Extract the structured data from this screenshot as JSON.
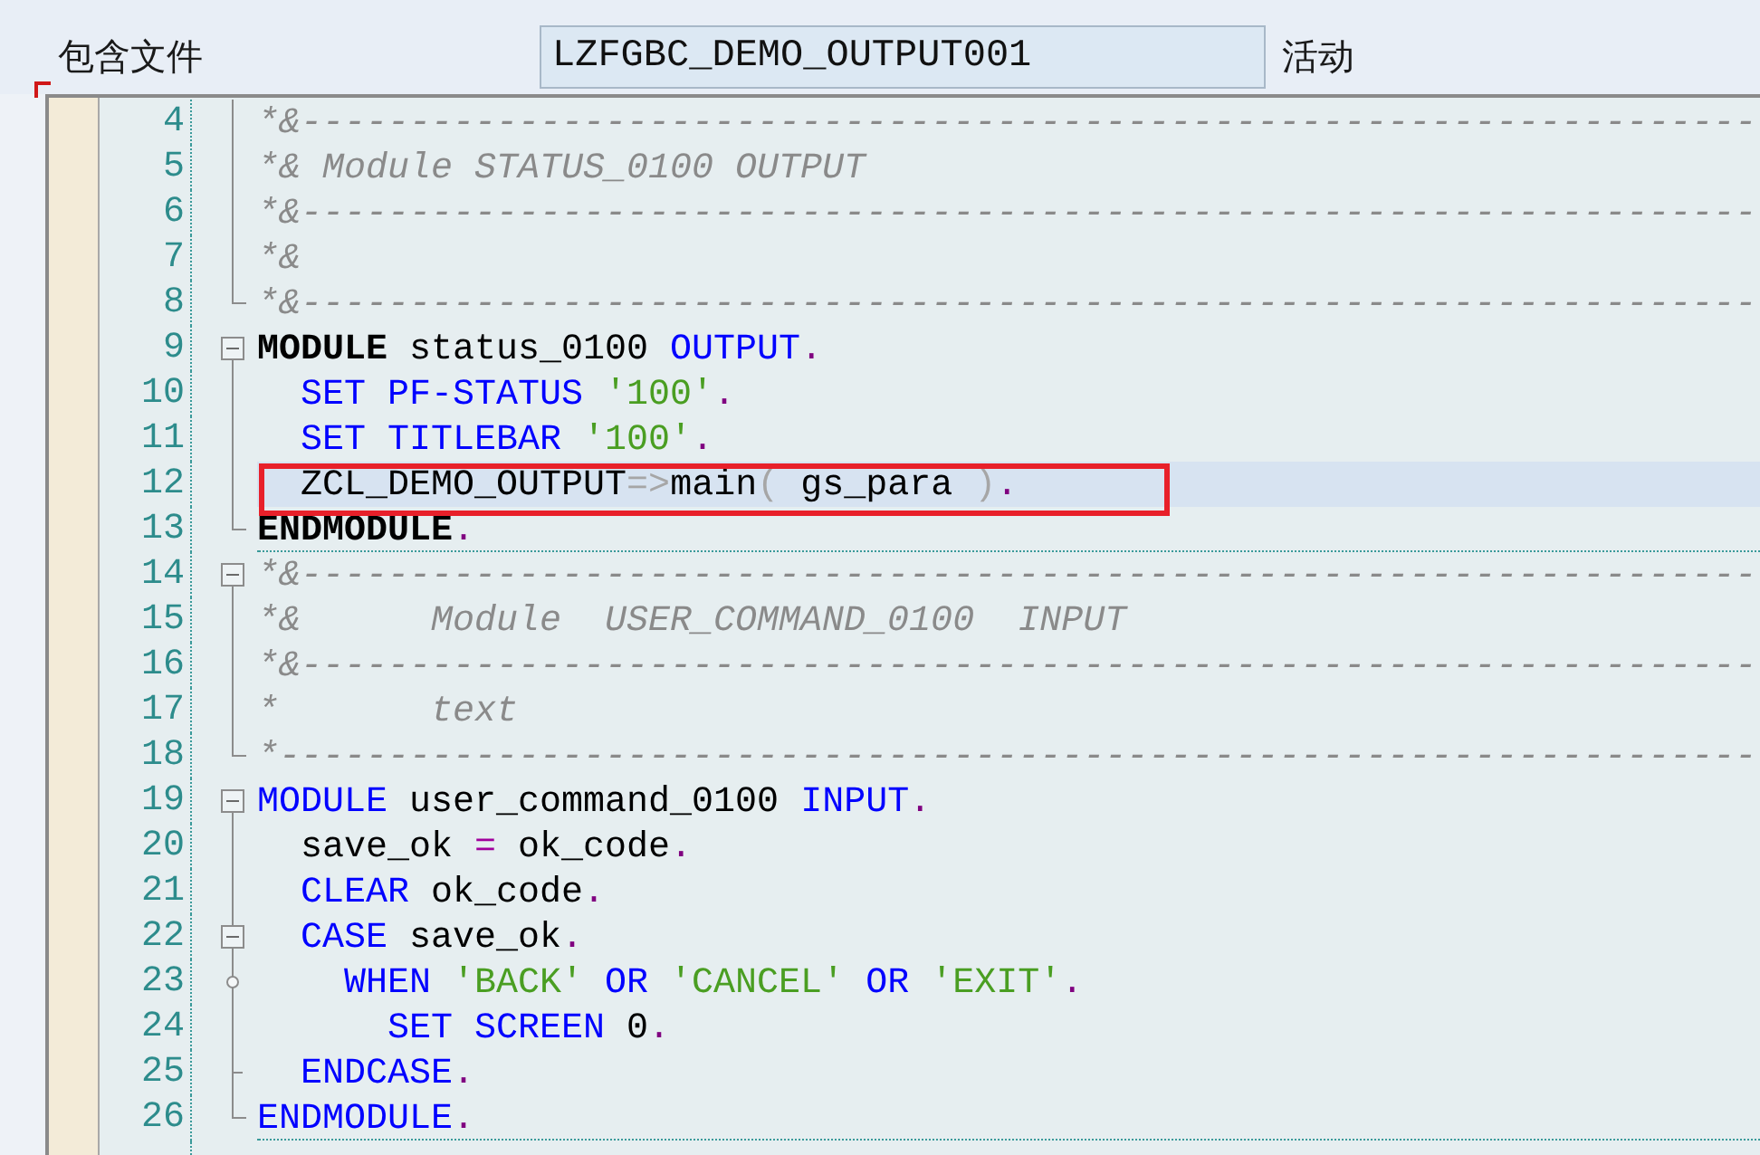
{
  "header": {
    "label": "包含文件",
    "file_name": "LZFGBC_DEMO_OUTPUT001",
    "status": "活动"
  },
  "editor": {
    "lines": [
      {
        "number": "4",
        "fold": {
          "kind": "line"
        },
        "current": false,
        "boxed": false,
        "block_end": false,
        "tokens": [
          {
            "text": "*&-------------------------------------------------------------------",
            "kind": "comment"
          }
        ]
      },
      {
        "number": "5",
        "fold": {
          "kind": "line"
        },
        "current": false,
        "boxed": false,
        "block_end": false,
        "tokens": [
          {
            "text": "*& Module STATUS_0100 OUTPUT",
            "kind": "comment"
          }
        ]
      },
      {
        "number": "6",
        "fold": {
          "kind": "line"
        },
        "current": false,
        "boxed": false,
        "block_end": false,
        "tokens": [
          {
            "text": "*&-------------------------------------------------------------------",
            "kind": "comment"
          }
        ]
      },
      {
        "number": "7",
        "fold": {
          "kind": "line"
        },
        "current": false,
        "boxed": false,
        "block_end": false,
        "tokens": [
          {
            "text": "*&",
            "kind": "comment"
          }
        ]
      },
      {
        "number": "8",
        "fold": {
          "kind": "end"
        },
        "current": false,
        "boxed": false,
        "block_end": false,
        "tokens": [
          {
            "text": "*&-------------------------------------------------------------------",
            "kind": "comment"
          }
        ]
      },
      {
        "number": "9",
        "fold": {
          "kind": "start",
          "expanded": true
        },
        "current": false,
        "boxed": false,
        "block_end": false,
        "tokens": [
          {
            "text": "MODULE",
            "kind": "keyword_bold"
          },
          {
            "text": " status_0100",
            "kind": "plain"
          },
          {
            "text": " OUTPUT",
            "kind": "keyword"
          },
          {
            "text": ".",
            "kind": "punct"
          }
        ]
      },
      {
        "number": "10",
        "fold": {
          "kind": "line"
        },
        "current": false,
        "boxed": false,
        "block_end": false,
        "tokens": [
          {
            "text": "  SET PF-STATUS",
            "kind": "keyword"
          },
          {
            "text": " '100'",
            "kind": "string"
          },
          {
            "text": ".",
            "kind": "punct"
          }
        ]
      },
      {
        "number": "11",
        "fold": {
          "kind": "line"
        },
        "current": false,
        "boxed": false,
        "block_end": false,
        "tokens": [
          {
            "text": "  SET TITLEBAR",
            "kind": "keyword"
          },
          {
            "text": " '100'",
            "kind": "string"
          },
          {
            "text": ".",
            "kind": "punct"
          }
        ]
      },
      {
        "number": "12",
        "fold": {
          "kind": "line"
        },
        "current": true,
        "boxed": true,
        "block_end": false,
        "tokens": [
          {
            "text": "  ZCL_DEMO_OUTPUT",
            "kind": "plain"
          },
          {
            "text": "=>",
            "kind": "symbol"
          },
          {
            "text": "main",
            "kind": "plain"
          },
          {
            "text": "(",
            "kind": "symbol"
          },
          {
            "text": " gs_para ",
            "kind": "plain"
          },
          {
            "text": ")",
            "kind": "symbol"
          },
          {
            "text": ".",
            "kind": "punct"
          }
        ]
      },
      {
        "number": "13",
        "fold": {
          "kind": "end"
        },
        "current": false,
        "boxed": false,
        "block_end": true,
        "tokens": [
          {
            "text": "ENDMODULE",
            "kind": "keyword_bold"
          },
          {
            "text": ".",
            "kind": "punct"
          }
        ]
      },
      {
        "number": "14",
        "fold": {
          "kind": "start",
          "expanded": true
        },
        "current": false,
        "boxed": false,
        "block_end": false,
        "tokens": [
          {
            "text": "*&-------------------------------------------------------------------",
            "kind": "comment"
          }
        ]
      },
      {
        "number": "15",
        "fold": {
          "kind": "line"
        },
        "current": false,
        "boxed": false,
        "block_end": false,
        "tokens": [
          {
            "text": "*&      Module  USER_COMMAND_0100  INPUT",
            "kind": "comment"
          }
        ]
      },
      {
        "number": "16",
        "fold": {
          "kind": "line"
        },
        "current": false,
        "boxed": false,
        "block_end": false,
        "tokens": [
          {
            "text": "*&-------------------------------------------------------------------",
            "kind": "comment"
          }
        ]
      },
      {
        "number": "17",
        "fold": {
          "kind": "line"
        },
        "current": false,
        "boxed": false,
        "block_end": false,
        "tokens": [
          {
            "text": "*       text",
            "kind": "comment"
          }
        ]
      },
      {
        "number": "18",
        "fold": {
          "kind": "end"
        },
        "current": false,
        "boxed": false,
        "block_end": false,
        "tokens": [
          {
            "text": "*--------------------------------------------------------------------",
            "kind": "comment"
          }
        ]
      },
      {
        "number": "19",
        "fold": {
          "kind": "start",
          "expanded": true
        },
        "current": false,
        "boxed": false,
        "block_end": false,
        "tokens": [
          {
            "text": "MODULE",
            "kind": "keyword"
          },
          {
            "text": " user_command_0100",
            "kind": "plain"
          },
          {
            "text": " INPUT",
            "kind": "keyword"
          },
          {
            "text": ".",
            "kind": "punct"
          }
        ]
      },
      {
        "number": "20",
        "fold": {
          "kind": "line"
        },
        "current": false,
        "boxed": false,
        "block_end": false,
        "tokens": [
          {
            "text": "  save_ok",
            "kind": "plain"
          },
          {
            "text": " =",
            "kind": "operator"
          },
          {
            "text": " ok_code",
            "kind": "plain"
          },
          {
            "text": ".",
            "kind": "punct"
          }
        ]
      },
      {
        "number": "21",
        "fold": {
          "kind": "line"
        },
        "current": false,
        "boxed": false,
        "block_end": false,
        "tokens": [
          {
            "text": "  CLEAR",
            "kind": "keyword"
          },
          {
            "text": " ok_code",
            "kind": "plain"
          },
          {
            "text": ".",
            "kind": "punct"
          }
        ]
      },
      {
        "number": "22",
        "fold": {
          "kind": "start",
          "expanded": true
        },
        "current": false,
        "boxed": false,
        "block_end": false,
        "tokens": [
          {
            "text": "  CASE",
            "kind": "keyword"
          },
          {
            "text": " save_ok",
            "kind": "plain"
          },
          {
            "text": ".",
            "kind": "punct"
          }
        ]
      },
      {
        "number": "23",
        "fold": {
          "kind": "dot"
        },
        "current": false,
        "boxed": false,
        "block_end": false,
        "tokens": [
          {
            "text": "    WHEN",
            "kind": "keyword"
          },
          {
            "text": " 'BACK'",
            "kind": "string"
          },
          {
            "text": " OR",
            "kind": "keyword"
          },
          {
            "text": " 'CANCEL'",
            "kind": "string"
          },
          {
            "text": " OR",
            "kind": "keyword"
          },
          {
            "text": " 'EXIT'",
            "kind": "string"
          },
          {
            "text": ".",
            "kind": "punct"
          }
        ]
      },
      {
        "number": "24",
        "fold": {
          "kind": "line"
        },
        "current": false,
        "boxed": false,
        "block_end": false,
        "tokens": [
          {
            "text": "      SET SCREEN",
            "kind": "keyword"
          },
          {
            "text": " 0",
            "kind": "plain"
          },
          {
            "text": ".",
            "kind": "punct"
          }
        ]
      },
      {
        "number": "25",
        "fold": {
          "kind": "tick"
        },
        "current": false,
        "boxed": false,
        "block_end": false,
        "tokens": [
          {
            "text": "  ENDCASE",
            "kind": "keyword"
          },
          {
            "text": ".",
            "kind": "punct"
          }
        ]
      },
      {
        "number": "26",
        "fold": {
          "kind": "end"
        },
        "current": false,
        "boxed": false,
        "block_end": true,
        "tokens": [
          {
            "text": "ENDMODULE",
            "kind": "keyword"
          },
          {
            "text": ".",
            "kind": "punct"
          }
        ]
      }
    ]
  }
}
